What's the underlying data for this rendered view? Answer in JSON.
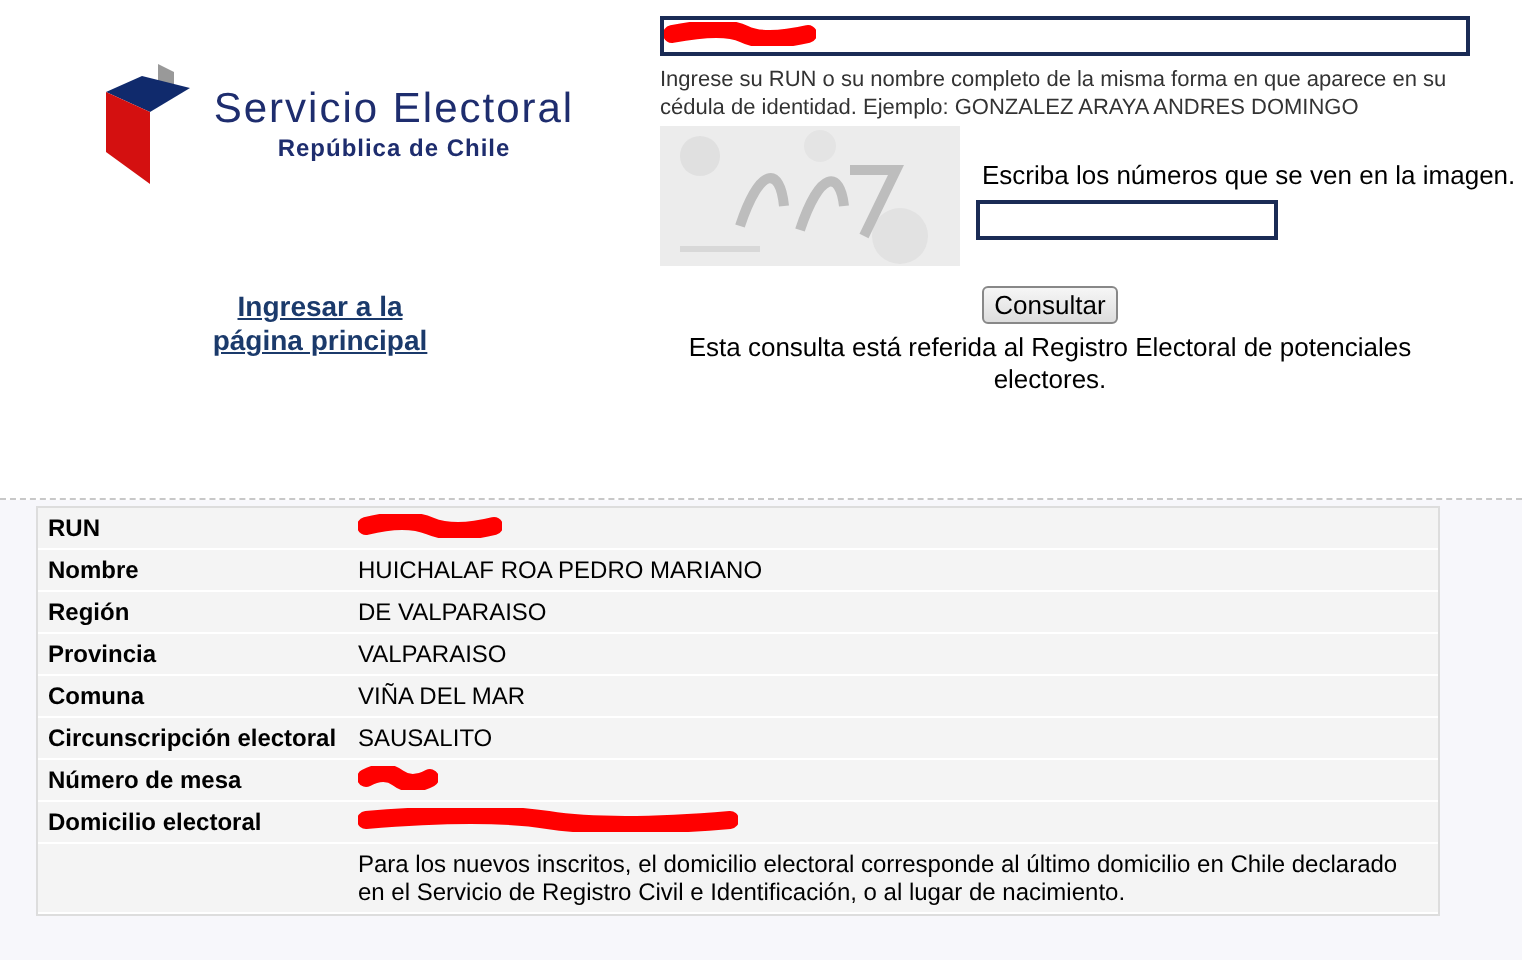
{
  "logo": {
    "title": "Servicio Electoral",
    "subtitle": "República de Chile"
  },
  "home_link": "Ingresar a la página principal",
  "search": {
    "redacted": true,
    "hint": "Ingrese su RUN o su nombre completo de la misma forma en que aparece en su cédula de identidad. Ejemplo: GONZALEZ ARAYA ANDRES DOMINGO"
  },
  "captcha": {
    "kind": "picture",
    "label": "Escriba los números que se ven en la imagen."
  },
  "submit_button": "Consultar",
  "notice": "Esta consulta está referida al Registro Electoral de potenciales electores.",
  "results": [
    {
      "label": "RUN",
      "redacted": true
    },
    {
      "label": "Nombre",
      "value": "HUICHALAF ROA PEDRO MARIANO",
      "redacted": false
    },
    {
      "label": "Región",
      "value": "DE VALPARAISO",
      "redacted": false
    },
    {
      "label": "Provincia",
      "value": "VALPARAISO",
      "redacted": false
    },
    {
      "label": "Comuna",
      "value": "VIÑA DEL MAR",
      "redacted": false
    },
    {
      "label": "Circunscripción electoral",
      "value": "SAUSALITO",
      "redacted": false
    },
    {
      "label": "Número de mesa",
      "redacted": true
    },
    {
      "label": "Domicilio electoral",
      "redacted": true
    },
    {
      "value": "Para los nuevos inscritos, el domicilio electoral corresponde al último domicilio en Chile declarado en el Servicio de Registro Civil e Identificación, o al lugar de nacimiento.",
      "redacted": false
    }
  ]
}
